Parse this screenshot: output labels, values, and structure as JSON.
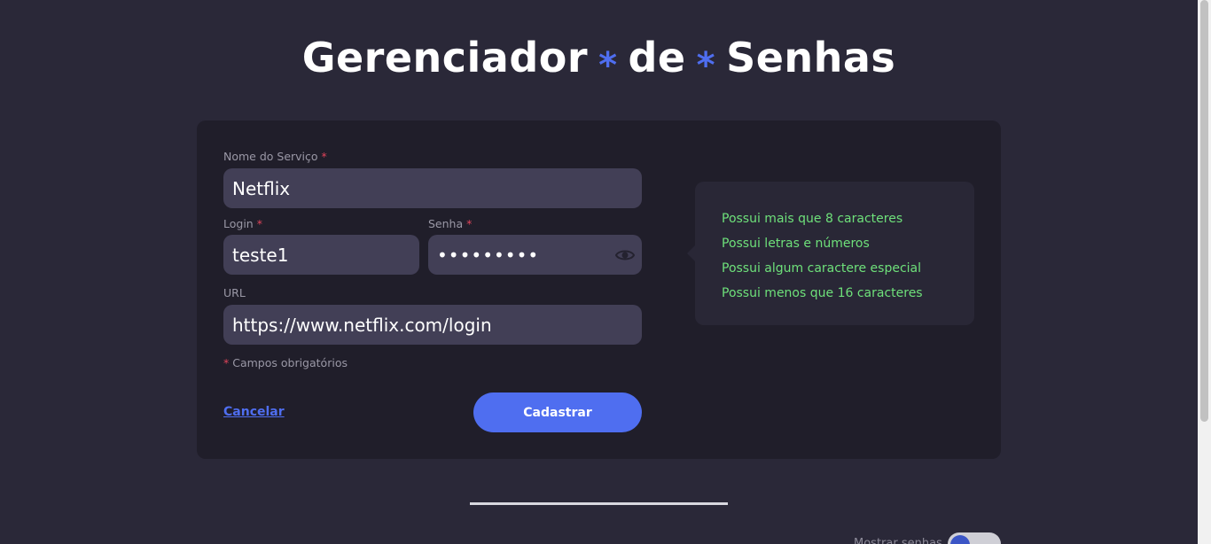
{
  "title": {
    "word1": "Gerenciador",
    "word2": "de",
    "word3": "Senhas",
    "separator": "*"
  },
  "form": {
    "service_label": "Nome do Serviço",
    "service_value": "Netflix",
    "login_label": "Login",
    "login_value": "teste1",
    "password_label": "Senha",
    "password_masked": "•••••••••",
    "url_label": "URL",
    "url_value": "https://www.netflix.com/login",
    "required_marker": "*",
    "required_note": "Campos obrigatórios",
    "cancel_label": "Cancelar",
    "submit_label": "Cadastrar"
  },
  "validation": {
    "items": [
      "Possui mais que 8 caracteres",
      "Possui letras e números",
      "Possui algum caractere especial",
      "Possui menos que 16 caracteres"
    ],
    "valid_color": "#6ee07a"
  },
  "footer": {
    "toggle_label": "Mostrar senhas"
  },
  "colors": {
    "accent": "#4f6ef0",
    "background": "#2a2838",
    "card": "#201e2a",
    "required": "#e0445a"
  }
}
